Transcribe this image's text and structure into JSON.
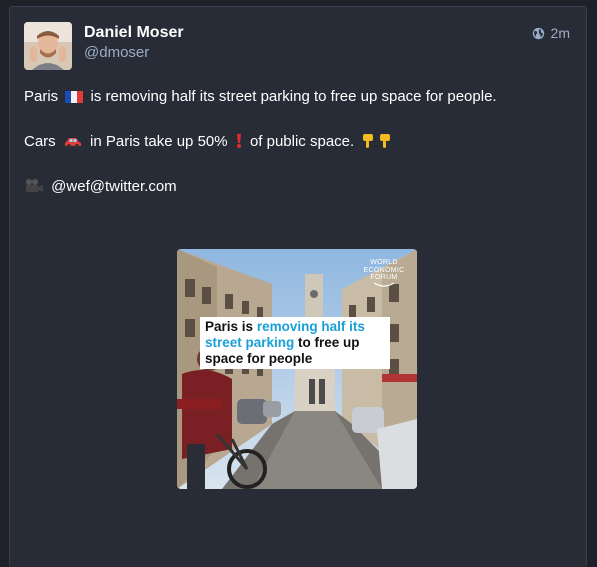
{
  "post": {
    "display_name": "Daniel Moser",
    "handle": "@dmoser",
    "timestamp": "2m",
    "visibility_icon": "globe-icon",
    "lines": [
      {
        "text_before": "Paris",
        "emoji": "flag-france",
        "text_after": "is removing half its street parking to free up space for people."
      },
      {
        "text_before": "Cars",
        "emoji": "car",
        "text_middle": "in Paris take up 50%",
        "emoji2": "exclamation",
        "text_after": "of public space.",
        "emoji3": "pointing-down"
      },
      {
        "emoji": "movie-camera",
        "text_after": "@wef@twitter.com"
      }
    ]
  },
  "media": {
    "caption_part1": "Paris is",
    "caption_highlight": "removing half its street parking",
    "caption_part2": "to free up space for people",
    "logo_line1": "WORLD",
    "logo_line2": "ECONOMIC",
    "logo_line3": "FORUM"
  },
  "colors": {
    "background": "#1f2128",
    "card": "#282c37",
    "text": "#ffffff",
    "muted": "#9baec8",
    "highlight": "#1aa0d8"
  }
}
